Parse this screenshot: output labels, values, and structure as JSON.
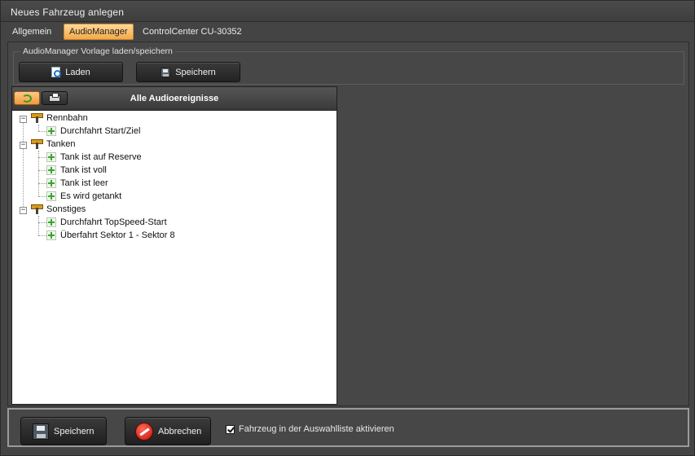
{
  "window": {
    "title": "Neues Fahrzeug anlegen"
  },
  "tabs": [
    {
      "label": "Allgemein",
      "active": false
    },
    {
      "label": "AudioManager",
      "active": true
    },
    {
      "label": "ControlCenter CU-30352",
      "active": false
    }
  ],
  "template_group": {
    "title": "AudioManager Vorlage laden/speichern",
    "load_label": "Laden",
    "save_label": "Speichern"
  },
  "events_panel": {
    "title": "Alle Audioereignisse",
    "tree": [
      {
        "label": "Rennbahn",
        "icon": "drill-icon",
        "expanded": true,
        "children": [
          "Durchfahrt Start/Ziel"
        ]
      },
      {
        "label": "Tanken",
        "icon": "drill-icon",
        "expanded": true,
        "children": [
          "Tank ist auf Reserve",
          "Tank ist voll",
          "Tank ist leer",
          "Es wird getankt"
        ]
      },
      {
        "label": "Sonstiges",
        "icon": "drill-icon",
        "expanded": true,
        "children": [
          "Durchfahrt TopSpeed-Start",
          "Überfahrt Sektor 1 - Sektor 8"
        ]
      }
    ]
  },
  "footer": {
    "save_label": "Speichern",
    "cancel_label": "Abbrechen",
    "activate_checkbox": {
      "label": "Fahrzeug in der Auswahlliste aktivieren",
      "checked": true
    }
  },
  "colors": {
    "accent": "#f3a94a",
    "background": "#444444",
    "plus_green": "#37a72c"
  }
}
